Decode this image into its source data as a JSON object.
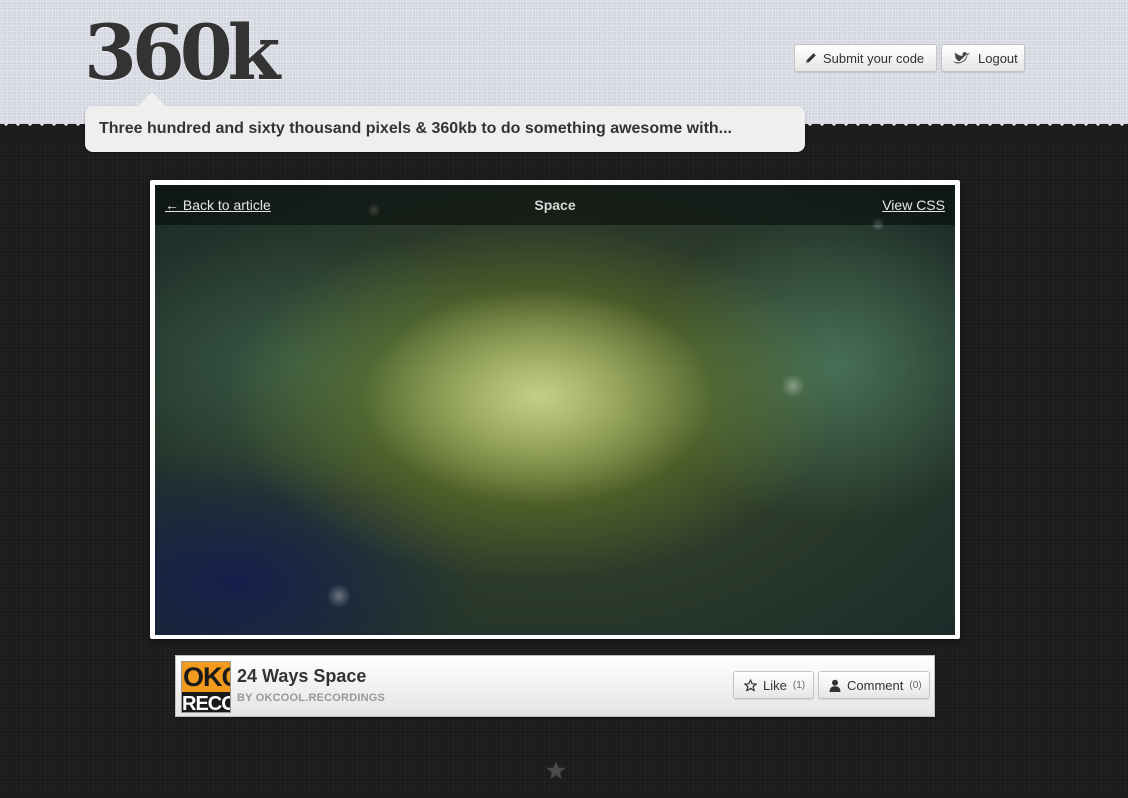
{
  "header": {
    "logo": "360k",
    "tagline": "Three hundred and sixty thousand pixels & 360kb to do something awesome with...",
    "submit_label": "Submit your code",
    "logout_label": "Logout"
  },
  "viewer": {
    "back_link": "← Back to article",
    "title": "Space",
    "css_link": "View CSS"
  },
  "entry": {
    "thumb_line1": "OKC",
    "thumb_line2": "RECO",
    "title": "24 Ways Space",
    "author": "BY OKCOOL.RECORDINGS",
    "like_label": "Like",
    "like_count": "(1)",
    "comment_label": "Comment",
    "comment_count": "(0)"
  },
  "icons": {
    "submit": "pencil-icon",
    "logout": "twitter-bird-icon",
    "like": "star-outline-icon",
    "comment": "person-icon",
    "footer": "star-icon"
  },
  "colors": {
    "header_bg": "#d6d9e2",
    "page_bg": "#1c1c1c",
    "thumb_orange": "#f29a1d"
  }
}
